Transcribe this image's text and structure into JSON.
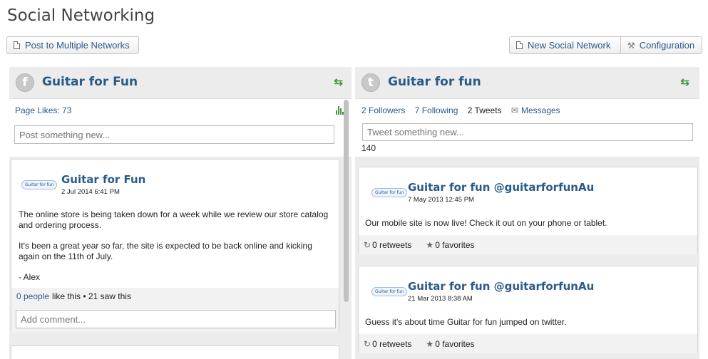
{
  "page": {
    "title": "Social Networking"
  },
  "toolbar": {
    "post_multi": "Post to Multiple Networks",
    "new_network": "New Social Network",
    "configuration": "Configuration"
  },
  "facebook": {
    "icon": "f",
    "title": "Guitar for Fun",
    "page_likes": "Page Likes: 73",
    "compose_placeholder": "Post something new...",
    "post": {
      "author": "Guitar for Fun",
      "avatar_text": "Guitar for fun",
      "date": "2 Jul 2014 6:41 PM",
      "paragraphs": [
        "The online store is being taken down for a week while we review our store catalog and ordering process.",
        "It's been a great year so far, the site is expected to be back online and kicking again on the 11th of July.",
        "- Alex"
      ],
      "likes_link": "0 people",
      "likes_rest": "like this • 21 saw this",
      "comment_placeholder": "Add comment..."
    }
  },
  "twitter": {
    "icon": "t",
    "title": "Guitar for fun",
    "followers": "2 Followers",
    "following": "7 Following",
    "tweets": "2 Tweets",
    "messages": "Messages",
    "compose_placeholder": "Tweet something new...",
    "char_count": "140",
    "tweets_list": [
      {
        "author": "Guitar for fun  @guitarforfunAu",
        "avatar_text": "Guitar for fun",
        "date": "7 May 2013 12:45 PM",
        "text": "Our mobile site is now live! Check it out on your phone or tablet.",
        "retweets": "0 retweets",
        "favorites": "0 favorites"
      },
      {
        "author": "Guitar for fun  @guitarforfunAu",
        "avatar_text": "Guitar for fun",
        "date": "21 Mar 2013 8:38 AM",
        "text": "Guess it's about time Guitar for fun jumped on twitter.",
        "retweets": "0 retweets",
        "favorites": "0 favorites"
      }
    ]
  },
  "colors": {
    "link": "#2a5a8a",
    "refresh": "#3a9a3a",
    "panel_bg": "#ececec"
  }
}
